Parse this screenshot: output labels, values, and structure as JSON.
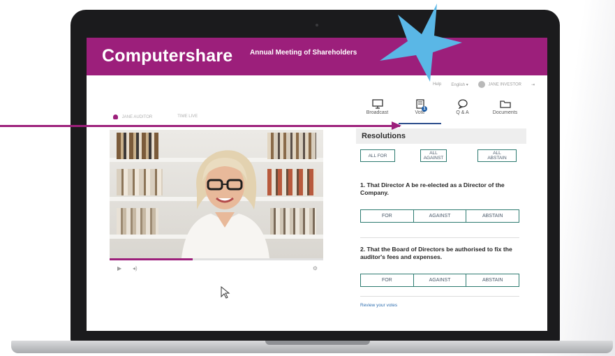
{
  "app": {
    "brand": "Computershare",
    "meeting_title": "Annual Meeting of Shareholders",
    "brand_color": "#9c1f7b",
    "accent_color": "#2c7a70",
    "star_color": "#5ab7e6"
  },
  "user_bar": {
    "help_label": "Help",
    "language_label": "English ▾",
    "user_name": "JANE INVESTOR"
  },
  "left_tabs": {
    "speaker_label": "JANE AUDITOR",
    "time_label": "TIME LIVE"
  },
  "nav": {
    "tabs": [
      {
        "label": "Broadcast",
        "icon": "monitor-icon"
      },
      {
        "label": "Vote",
        "icon": "document-vote-icon",
        "badge": "1",
        "active": true
      },
      {
        "label": "Q & A",
        "icon": "speech-bubble-icon"
      },
      {
        "label": "Documents",
        "icon": "folder-icon"
      }
    ]
  },
  "resolutions": {
    "title": "Resolutions",
    "bulk": {
      "all_for": "ALL FOR",
      "all_against": "ALL AGAINST",
      "all_abstain": "ALL ABSTAIN"
    },
    "items": [
      {
        "text": "1. That Director A be re-elected as a Director of the Company.",
        "options": [
          "FOR",
          "AGAINST",
          "ABSTAIN"
        ]
      },
      {
        "text": "2. That the Board of Directors be authorised to fix the auditor's fees and expenses.",
        "options": [
          "FOR",
          "AGAINST",
          "ABSTAIN"
        ]
      }
    ],
    "review_link": "Review your votes"
  },
  "video": {
    "progress": 0.39
  }
}
